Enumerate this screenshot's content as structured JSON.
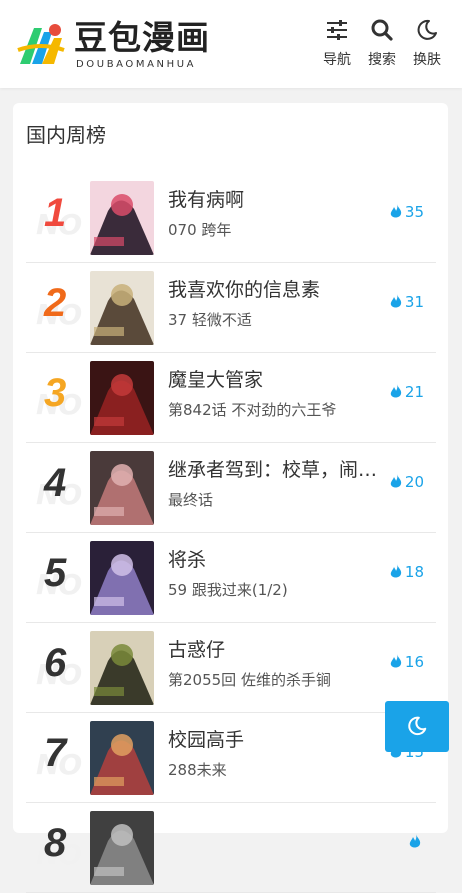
{
  "brand": {
    "name": "豆包漫画",
    "subtitle": "DOUBAOMANHUA",
    "colors": [
      "#2ecc71",
      "#1aa3e8",
      "#f5b800",
      "#e74c3c"
    ]
  },
  "nav": {
    "items": [
      {
        "label": "导航",
        "icon": "sliders-icon"
      },
      {
        "label": "搜索",
        "icon": "search-icon"
      },
      {
        "label": "换肤",
        "icon": "moon-icon"
      }
    ]
  },
  "section": {
    "title": "国内周榜"
  },
  "rank_colors": [
    "#f04a3e",
    "#f06a1a",
    "#f5a623",
    "#333333",
    "#333333",
    "#333333",
    "#333333",
    "#333333"
  ],
  "accent_color": "#1aa3e8",
  "ranking": [
    {
      "rank": "1",
      "title": "我有病啊",
      "chapter": "070 跨年",
      "hot": "35"
    },
    {
      "rank": "2",
      "title": "我喜欢你的信息素",
      "chapter": "37 轻微不适",
      "hot": "31"
    },
    {
      "rank": "3",
      "title": "魔皇大管家",
      "chapter": "第842话 不对劲的六王爷",
      "hot": "21"
    },
    {
      "rank": "4",
      "title": "继承者驾到：校草，闹够了没",
      "chapter": "最终话",
      "hot": "20"
    },
    {
      "rank": "5",
      "title": "将杀",
      "chapter": "59 跟我过来(1/2)",
      "hot": "18"
    },
    {
      "rank": "6",
      "title": "古惑仔",
      "chapter": "第2055回 佐维的杀手锏",
      "hot": "16"
    },
    {
      "rank": "7",
      "title": "校园高手",
      "chapter": "288未来",
      "hot": "15"
    },
    {
      "rank": "8",
      "title": "",
      "chapter": "",
      "hot": ""
    }
  ],
  "rank_watermark": "NO",
  "fab": {
    "icon": "moon-icon"
  }
}
